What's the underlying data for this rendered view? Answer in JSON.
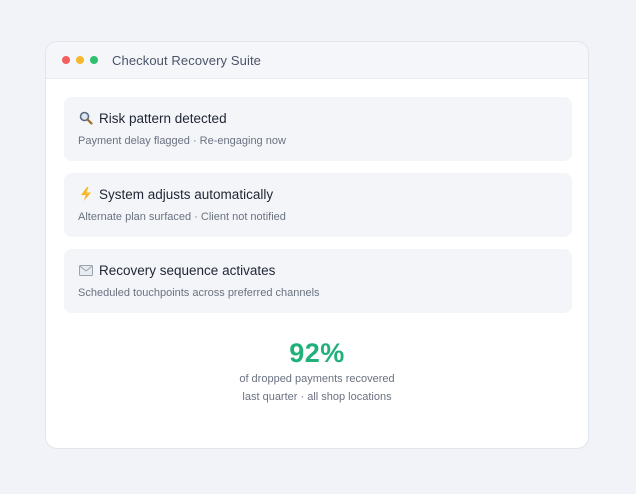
{
  "window": {
    "title": "Checkout Recovery Suite",
    "controls": [
      "close",
      "minimize",
      "maximize"
    ]
  },
  "steps": [
    {
      "icon": "magnifier-icon",
      "title": "Risk pattern detected",
      "subtitle": "Payment delay flagged · Re-engaging now"
    },
    {
      "icon": "lightning-icon",
      "title": "System adjusts automatically",
      "subtitle": "Alternate plan surfaced · Client not notified"
    },
    {
      "icon": "envelope-icon",
      "title": "Recovery sequence activates",
      "subtitle": "Scheduled touchpoints across preferred channels"
    }
  ],
  "stat": {
    "value": "92%",
    "line1": "of dropped payments recovered",
    "line2": "last quarter · all shop locations"
  },
  "colors": {
    "accent": "#22b07a",
    "close": "#f25f5c",
    "minimize": "#f5b82e",
    "maximize": "#2fbf71"
  }
}
